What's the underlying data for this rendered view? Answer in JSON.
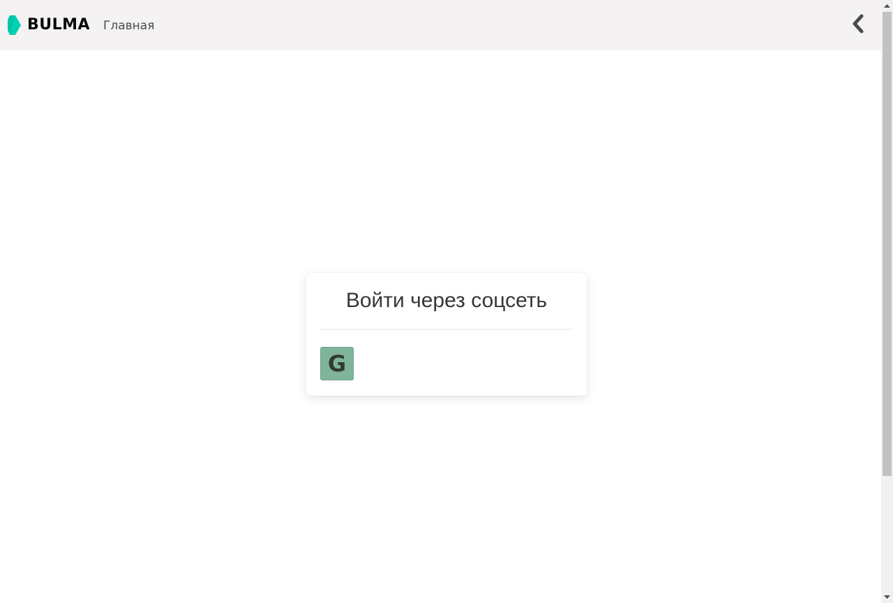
{
  "navbar": {
    "brand": "BULMA",
    "brand_color": "#00d1b2",
    "links": [
      {
        "label": "Главная"
      }
    ],
    "back_icon": "chevron-left-icon"
  },
  "card": {
    "title": "Войти через соцсеть",
    "providers": [
      {
        "name": "google",
        "letter": "G",
        "color": "#7fb39a"
      }
    ]
  },
  "scrollbar": {
    "visible": true
  }
}
